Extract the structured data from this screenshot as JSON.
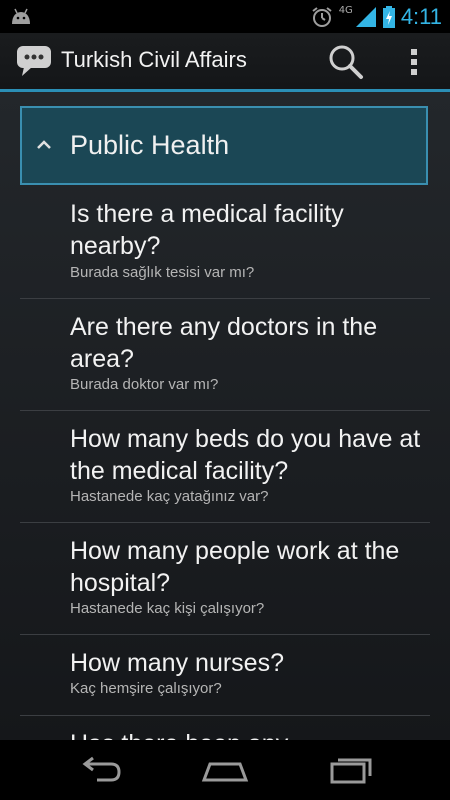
{
  "status": {
    "network": "4G",
    "time": "4:11"
  },
  "header": {
    "title": "Turkish Civil Affairs",
    "search_icon": "search-icon",
    "overflow_icon": "overflow-menu-icon"
  },
  "colors": {
    "accent": "#33b5e5",
    "group_bg": "#1b4755",
    "group_border": "#3a8fb0",
    "divider": "#2b8fb6"
  },
  "group": {
    "label": "Public Health",
    "expanded": true
  },
  "phrases": [
    {
      "en": "Is there a medical facility nearby?",
      "tr": "Burada sağlık tesisi var mı?"
    },
    {
      "en": "Are there any doctors in the area?",
      "tr": "Burada doktor var mı?"
    },
    {
      "en": "How many beds do you have at the medical facility?",
      "tr": "Hastanede kaç yatağınız var?"
    },
    {
      "en": "How many people work at the hospital?",
      "tr": "Hastanede kaç kişi çalışıyor?"
    },
    {
      "en": "How many nurses?",
      "tr": "Kaç hemşire çalışıyor?"
    },
    {
      "en": "Has there been any",
      "tr": ""
    }
  ]
}
